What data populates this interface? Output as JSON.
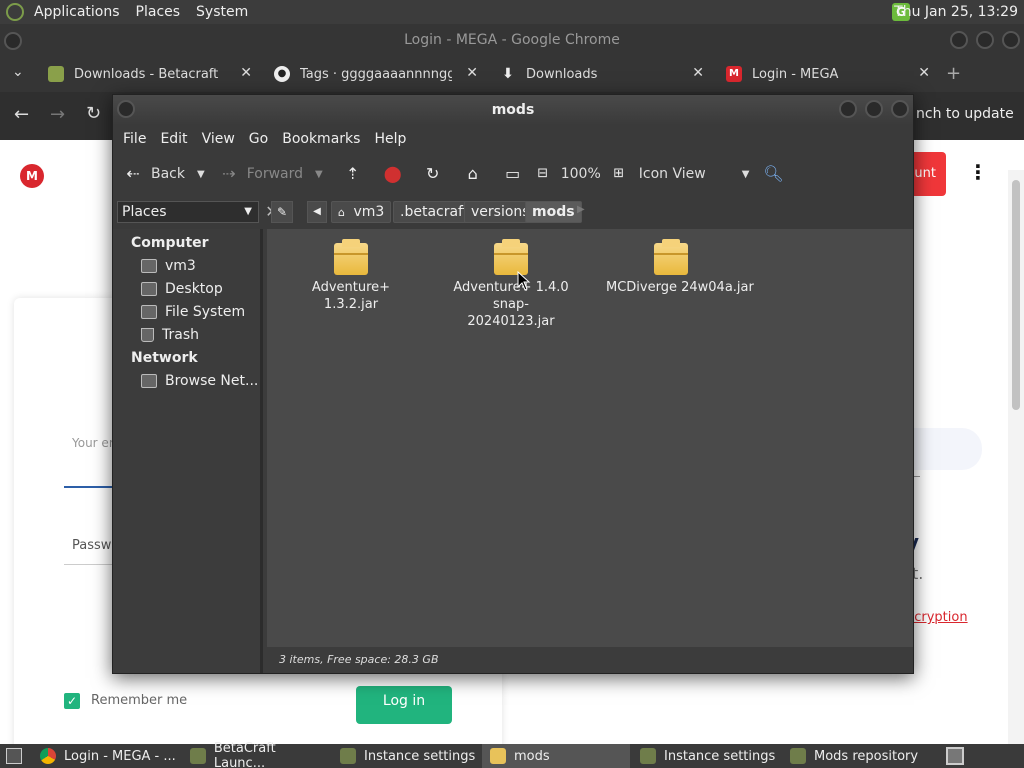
{
  "top_panel": {
    "menus": [
      "Applications",
      "Places",
      "System"
    ],
    "clock": "Thu Jan 25, 13:29",
    "tray_icon": "G"
  },
  "chrome": {
    "window_title": "Login - MEGA - Google Chrome",
    "tabs": [
      {
        "label": "Downloads - Betacraft",
        "icon": "betacraft-icon"
      },
      {
        "label": "Tags · ggggaaaannnngggg/",
        "icon": "github-icon"
      },
      {
        "label": "Downloads",
        "icon": "download-icon"
      },
      {
        "label": "Login - MEGA",
        "icon": "mega-icon"
      }
    ],
    "tab_close": "✕",
    "new_tab": "+",
    "update_label": "nch to update",
    "page": {
      "create_account_fragment": "unt",
      "email_fragment": "Your em",
      "password_fragment": "Passw",
      "remember_me": "Remember me",
      "login_button": "Log in",
      "right_fragment_1": "y",
      "right_fragment_2": "t.",
      "encryption_fragment": "ncryption"
    }
  },
  "file_manager": {
    "title": "mods",
    "menu": [
      "File",
      "Edit",
      "View",
      "Go",
      "Bookmarks",
      "Help"
    ],
    "toolbar": {
      "back": "Back",
      "forward": "Forward",
      "zoom": "100%",
      "view_mode": "Icon View"
    },
    "places_label": "Places",
    "breadcrumbs": [
      "vm3",
      ".betacraft",
      "versions",
      "mods"
    ],
    "sidebar": {
      "computer_header": "Computer",
      "computer_items": [
        "vm3",
        "Desktop",
        "File System",
        "Trash"
      ],
      "network_header": "Network",
      "network_items": [
        "Browse Net..."
      ]
    },
    "files": [
      {
        "name": "Adventure+ 1.3.2.jar"
      },
      {
        "name": "Adventure+ 1.4.0 snap-20240123.jar"
      },
      {
        "name": "MCDiverge 24w04a.jar"
      }
    ],
    "status": "3 items, Free space: 28.3 GB"
  },
  "taskbar": {
    "items": [
      {
        "label": "Login - MEGA - ...",
        "icon": "chrome-icon"
      },
      {
        "label": "BetaCraft Launc...",
        "icon": "betacraft-icon"
      },
      {
        "label": "Instance settings",
        "icon": "betacraft-icon"
      },
      {
        "label": "mods",
        "icon": "folder-icon"
      },
      {
        "label": "Instance settings",
        "icon": "betacraft-icon"
      },
      {
        "label": "Mods repository",
        "icon": "betacraft-icon"
      }
    ]
  },
  "colors": {
    "mega_red": "#d9272e",
    "login_green": "#21b47e",
    "folder_yellow": "#f0c14b"
  }
}
